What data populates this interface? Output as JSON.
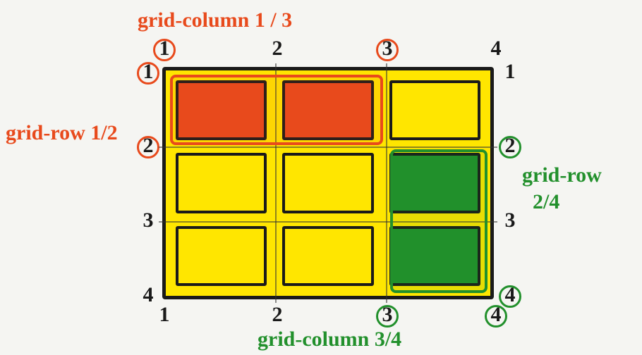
{
  "labels": {
    "red_col": "grid-column 1 / 3",
    "red_row": "grid-row 1/2",
    "green_row_line1": "grid-row",
    "green_row_line2": "2/4",
    "green_col": "grid-column 3/4"
  },
  "lines": {
    "cols": [
      "1",
      "2",
      "3",
      "4"
    ],
    "rows": [
      "1",
      "2",
      "3",
      "4"
    ]
  },
  "grid": {
    "columns": 3,
    "rows": 3,
    "red_region": {
      "grid_column": "1 / 3",
      "grid_row": "1 / 2"
    },
    "green_region": {
      "grid_column": "3 / 4",
      "grid_row": "2 / 4"
    }
  },
  "colors": {
    "yellow": "#ffe600",
    "red": "#e84a1c",
    "green": "#22902c",
    "ink": "#1a1a1a"
  }
}
